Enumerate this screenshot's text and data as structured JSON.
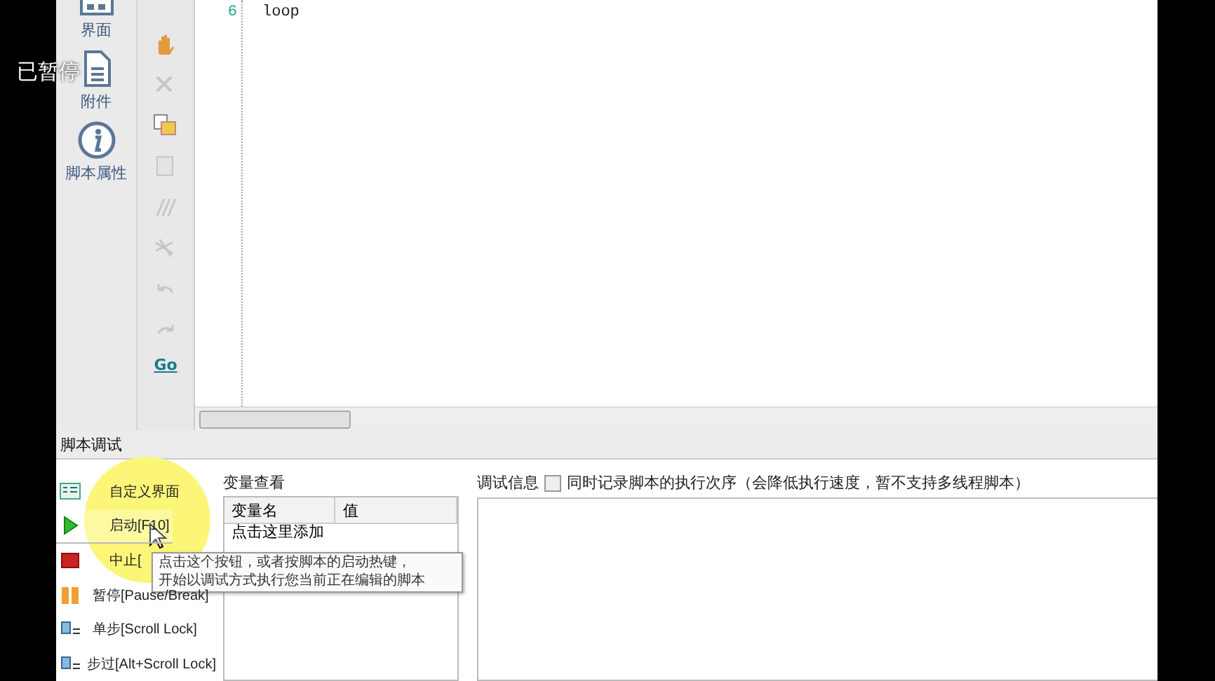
{
  "overlay_caption": "已暂停",
  "nav": [
    {
      "label": "界面"
    },
    {
      "label": "附件"
    },
    {
      "label": "脚本属性"
    }
  ],
  "toolbar": [
    {
      "disabled": false
    },
    {
      "disabled": true
    },
    {
      "disabled": false
    },
    {
      "disabled": true
    },
    {
      "disabled": true
    },
    {
      "disabled": true
    },
    {
      "disabled": true
    },
    {
      "disabled": true
    }
  ],
  "goto_button": "Go",
  "editor": {
    "lines": [
      {
        "number": "6",
        "code": "loop"
      }
    ]
  },
  "debug_panel": {
    "title": "脚本调试",
    "buttons": [
      {
        "label": "自定义界面",
        "pressed": false
      },
      {
        "label": "启动[F10]",
        "pressed": true
      },
      {
        "label": "中止[",
        "pressed": false
      },
      {
        "label": "暂停[Pause/Break]",
        "pressed": false
      },
      {
        "label": "单步[Scroll Lock]",
        "pressed": false
      },
      {
        "label": "步过[Alt+Scroll Lock]",
        "pressed": false
      }
    ],
    "variables": {
      "title": "变量查看",
      "columns": [
        "变量名",
        "值"
      ],
      "rows": [
        [
          "点击这里添加",
          ""
        ]
      ]
    },
    "debug_info": {
      "label": "调试信息",
      "option": {
        "label": "同时记录脚本的执行次序（会降低执行速度，暂不支持多线程脚本）",
        "checked": false
      }
    }
  },
  "tooltip": {
    "lines": [
      "点击这个按钮，或者按脚本的启动热键，",
      "开始以调试方式执行您当前正在编辑的脚本"
    ]
  }
}
